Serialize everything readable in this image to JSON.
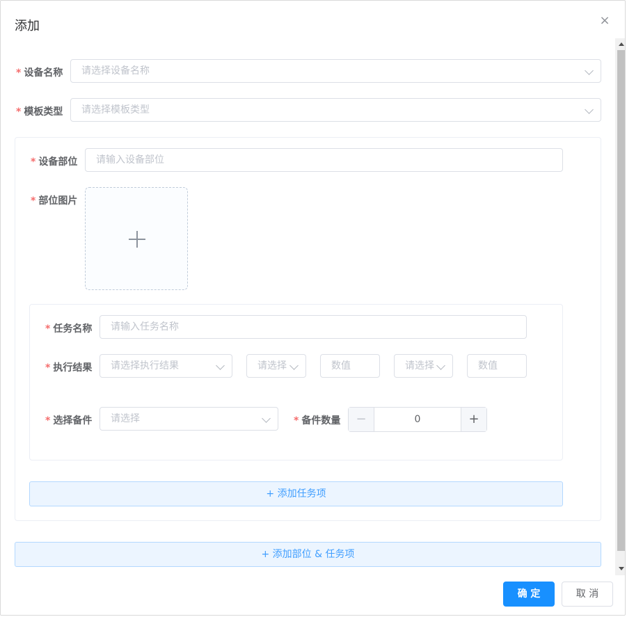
{
  "dialog": {
    "title": "添加",
    "close_icon": "×"
  },
  "form": {
    "device_name": {
      "label": "设备名称",
      "placeholder": "请选择设备名称"
    },
    "template_type": {
      "label": "模板类型",
      "placeholder": "请选择模板类型"
    },
    "part": {
      "name": {
        "label": "设备部位",
        "placeholder": "请输入设备部位"
      },
      "image": {
        "label": "部位图片",
        "icon": "plus-icon"
      },
      "task": {
        "name": {
          "label": "任务名称",
          "placeholder": "请输入任务名称"
        },
        "result": {
          "label": "执行结果",
          "placeholder": "请选择执行结果",
          "op1_placeholder": "请选择",
          "value1_placeholder": "数值",
          "op2_placeholder": "请选择",
          "value2_placeholder": "数值"
        },
        "spare_part": {
          "label": "选择备件",
          "placeholder": "请选择"
        },
        "spare_qty": {
          "label": "备件数量",
          "value": "0",
          "dec": "−",
          "inc": "+"
        }
      },
      "add_task_button": "+ 添加任务项"
    },
    "add_part_button": "+ 添加部位 & 任务项"
  },
  "footer": {
    "confirm": "确 定",
    "cancel": "取 消"
  },
  "colors": {
    "primary": "#1890ff",
    "required": "#f56c6c",
    "link": "#409eff"
  }
}
